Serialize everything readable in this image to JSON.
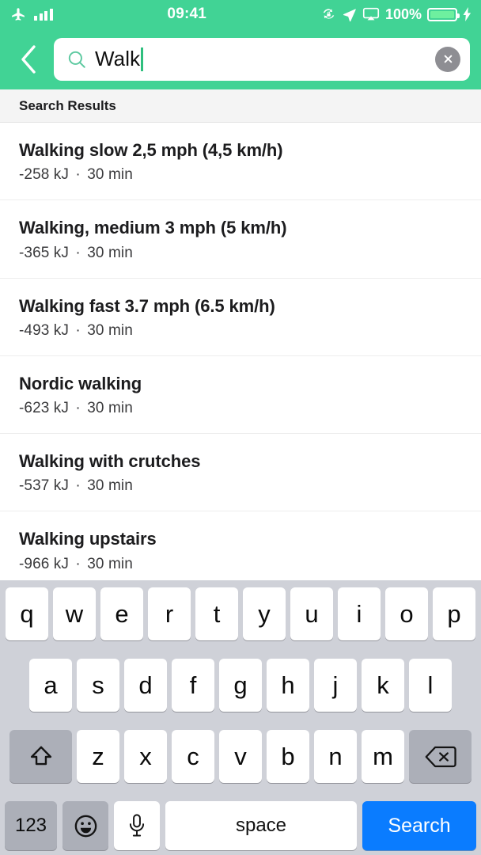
{
  "statusbar": {
    "airplane_icon": "airplane-icon",
    "signal_icon": "signal-bars-icon",
    "time": "09:41",
    "rotation_lock_icon": "rotation-lock-icon",
    "location_icon": "location-arrow-icon",
    "airplay_icon": "screen-mirroring-icon",
    "battery_percent": "100%",
    "battery_icon": "battery-icon",
    "charging_icon": "charging-bolt-icon"
  },
  "header": {
    "accent_color": "#41D395",
    "back_label": "back-chevron-icon",
    "search": {
      "value": "Walk",
      "placeholder": "Search",
      "search_icon": "search-icon",
      "clear_icon": "clear-circle-icon"
    }
  },
  "section": {
    "title": "Search Results"
  },
  "results": [
    {
      "title": "Walking slow 2,5 mph (4,5 km/h)",
      "energy": "-258 kJ",
      "separator": "·",
      "duration": "30 min"
    },
    {
      "title": "Walking, medium 3 mph (5 km/h)",
      "energy": "-365 kJ",
      "separator": "·",
      "duration": "30 min"
    },
    {
      "title": "Walking fast 3.7 mph (6.5 km/h)",
      "energy": "-493 kJ",
      "separator": "·",
      "duration": "30 min"
    },
    {
      "title": "Nordic walking",
      "energy": "-623 kJ",
      "separator": "·",
      "duration": "30 min"
    },
    {
      "title": "Walking with crutches",
      "energy": "-537 kJ",
      "separator": "·",
      "duration": "30 min"
    },
    {
      "title": "Walking upstairs",
      "energy": "-966 kJ",
      "separator": "·",
      "duration": "30 min"
    }
  ],
  "keyboard": {
    "row1": [
      "q",
      "w",
      "e",
      "r",
      "t",
      "y",
      "u",
      "i",
      "o",
      "p"
    ],
    "row2": [
      "a",
      "s",
      "d",
      "f",
      "g",
      "h",
      "j",
      "k",
      "l"
    ],
    "row3": [
      "z",
      "x",
      "c",
      "v",
      "b",
      "n",
      "m"
    ],
    "shift_label": "shift-icon",
    "delete_label": "backspace-icon",
    "numbers_label": "123",
    "emoji_label": "emoji-icon",
    "mic_label": "microphone-icon",
    "space_label": "space",
    "search_label": "Search",
    "search_key_color": "#0A7CFF"
  }
}
